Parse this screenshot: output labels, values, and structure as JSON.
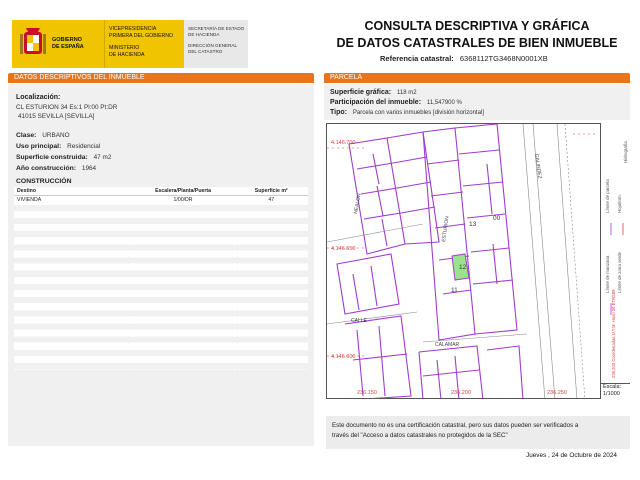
{
  "header": {
    "gov_line1": "GOBIERNO",
    "gov_line2": "DE ESPAÑA",
    "vice_line1": "VICEPRESIDENCIA",
    "vice_line2": "PRIMERA DEL GOBIERNO",
    "min_line1": "MINISTERIO",
    "min_line2": "DE HACIENDA",
    "sec_line1": "SECRETARÍA DE ESTADO",
    "sec_line2": "DE HACIENDA",
    "dir_line1": "DIRECCIÓN GENERAL",
    "dir_line2": "DEL CATASTRO",
    "title_line1": "CONSULTA DESCRIPTIVA Y GRÁFICA",
    "title_line2": "DE DATOS CATASTRALES DE BIEN INMUEBLE",
    "ref_label": "Referencia catastral:",
    "ref_value": "6368112TG3468N0001XB"
  },
  "left": {
    "bar_title": "DATOS DESCRIPTIVOS DEL INMUEBLE",
    "location_label": "Localización:",
    "address_line1": "CL ESTURION 34 Es:1 Pl:00 Pt:DR",
    "address_line2": "41015 SEVILLA [SEVILLA]",
    "clase_label": "Clase:",
    "clase_value": "URBANO",
    "uso_label": "Uso principal:",
    "uso_value": "Residencial",
    "superficie_label": "Superficie construida:",
    "superficie_value": "47 m2",
    "anio_label": "Año construcción:",
    "anio_value": "1964",
    "construccion_title": "CONSTRUCCIÓN",
    "table_headers": [
      "Destino",
      "Escalera/Planta/Puerta",
      "Superficie m²"
    ],
    "table_row": [
      "VIVIENDA",
      "1/00/DR",
      "47"
    ]
  },
  "right": {
    "bar_title": "PARCELA",
    "sup_grafica_label": "Superficie gráfica:",
    "sup_grafica_value": "118 m2",
    "participacion_label": "Participación del inmueble:",
    "participacion_value": "11,547900 %",
    "tipo_label": "Tipo:",
    "tipo_value": "Parcela con varios inmuebles [división horizontal]",
    "map_labels": {
      "y1": "4.146.700",
      "y2": "4.146.650",
      "y3": "4.146.600",
      "x1": "236.150",
      "x2": "236.200",
      "x3": "236.250",
      "street1": "NEALON",
      "street2": "ESTURION",
      "street3": "CALLE",
      "street4": "CALAMAR",
      "street5": "GALINDEZ",
      "parcel1": "13",
      "parcel2": "12",
      "parcel3": "11",
      "parcel4": "00"
    },
    "legend1": "Límite de parcela",
    "legend2": "Límite de manzana",
    "legend3": "Hoja/Inm.",
    "legend4": "Límite de zona verde",
    "legend5": "Hidrografía",
    "coords_note": "236.200 Coordenadas U.T.M. Huso 30 ETRS89",
    "scale_label": "Escala:",
    "scale_value": "1/1000"
  },
  "note": {
    "line1": "Este documento no es una certificación catastral, pero sus datos pueden ser verificados a",
    "line2": "través del \"Acceso a datos catastrales no protegidos de la SEC\""
  },
  "date": "Jueves , 24 de Octubre de 2024",
  "colors": {
    "accent_orange": "#e5761f",
    "logo_yellow": "#f1c400",
    "parcel_purple": "#a03ccf",
    "highlight_green": "#9be28a"
  }
}
